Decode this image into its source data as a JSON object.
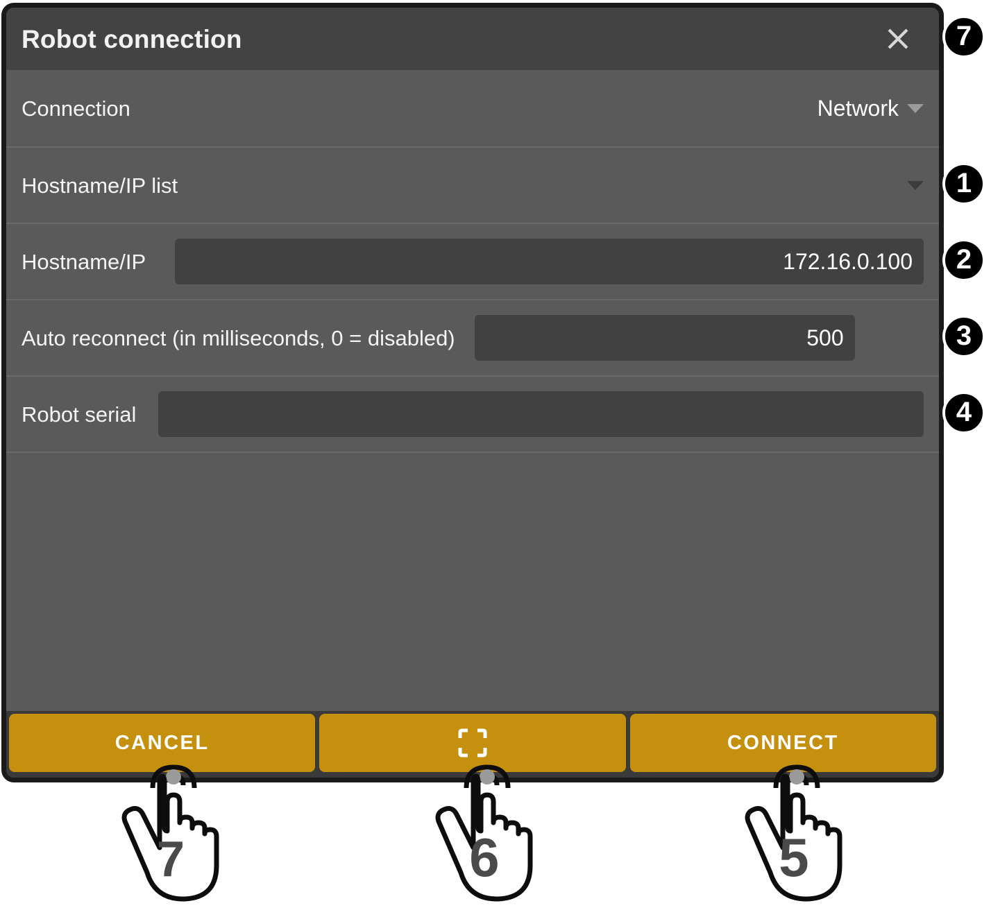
{
  "dialog": {
    "title": "Robot connection",
    "close_icon": "close-icon",
    "accent_color": "#c6900f",
    "title_bar_color": "#434343",
    "body_color": "#5a5a5a",
    "field_color": "#414141"
  },
  "rows": {
    "connection": {
      "label": "Connection",
      "value": "Network",
      "caret_icon": "chevron-down-icon"
    },
    "hostname_list": {
      "label": "Hostname/IP list",
      "value": "",
      "caret_icon": "chevron-down-icon"
    },
    "hostname_ip": {
      "label": "Hostname/IP",
      "value": "172.16.0.100"
    },
    "auto_reconnect": {
      "label": "Auto reconnect (in milliseconds, 0 = disabled)",
      "value": "500"
    },
    "robot_serial": {
      "label": "Robot serial",
      "value": ""
    }
  },
  "footer": {
    "cancel_label": "CANCEL",
    "scan_icon": "scan-frame-icon",
    "connect_label": "CONNECT"
  },
  "badges": [
    {
      "number": "1",
      "target": "hostname-ip-list-dropdown"
    },
    {
      "number": "2",
      "target": "hostname-ip-field"
    },
    {
      "number": "3",
      "target": "auto-reconnect-field"
    },
    {
      "number": "4",
      "target": "robot-serial-field"
    },
    {
      "number": "7",
      "target": "close-button"
    }
  ],
  "hand_callouts": [
    {
      "number": "7",
      "target": "cancel-button"
    },
    {
      "number": "6",
      "target": "scan-button"
    },
    {
      "number": "5",
      "target": "connect-button"
    }
  ]
}
